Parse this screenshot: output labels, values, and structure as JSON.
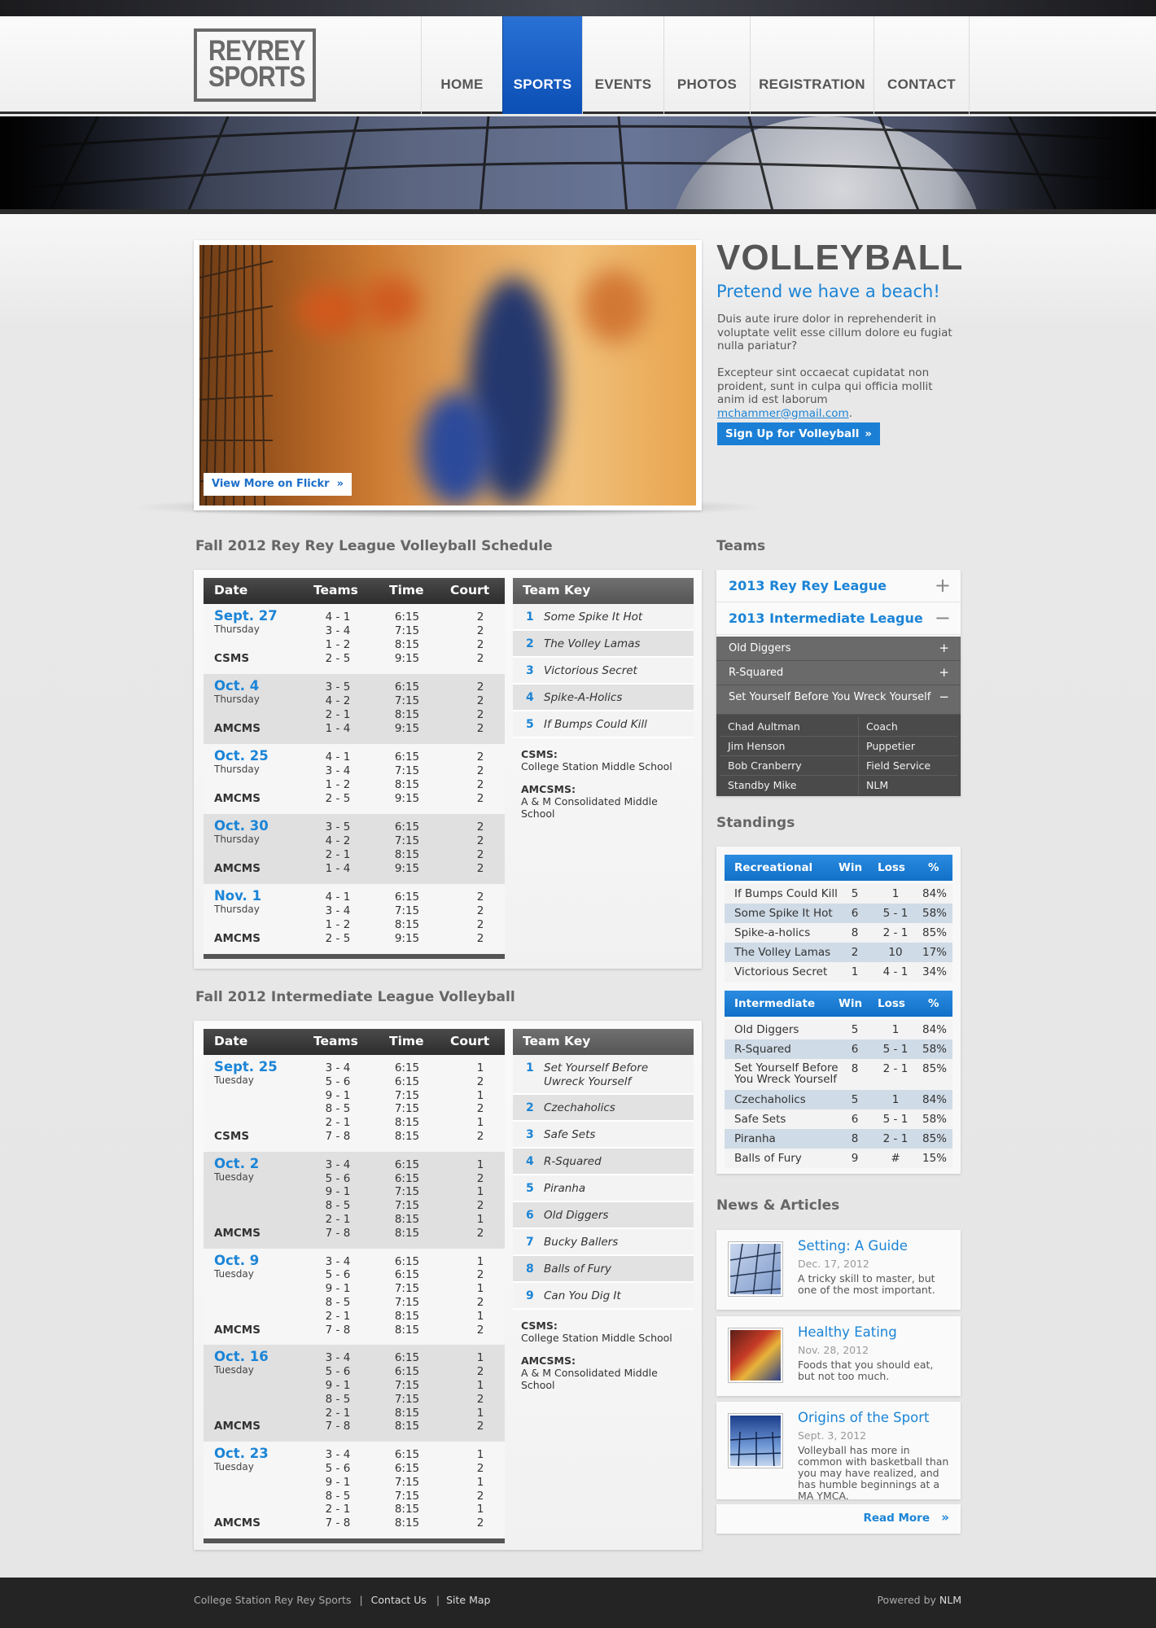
{
  "brand": {
    "logo_line1": "REYREY",
    "logo_line2": "SPORTS"
  },
  "nav": [
    "HOME",
    "SPORTS",
    "EVENTS",
    "PHOTOS",
    "REGISTRATION",
    "CONTACT"
  ],
  "nav_active": "SPORTS",
  "colors": {
    "accent": "#1b84d6",
    "nav_active": "#0b4fb5",
    "header_dark": "#2d2d2d",
    "footer": "#242424"
  },
  "feature": {
    "flickr_label": "View More on Flickr",
    "title": "VOLLEYBALL",
    "subtitle": "Pretend we have a beach!",
    "para1": "Duis aute irure dolor in reprehenderit in voluptate velit esse cillum dolore eu fugiat nulla pariatur?",
    "para2_text": "Excepteur sint occaecat cupidatat non proident, sunt in culpa qui officia mollit anim id est laborum ",
    "para2_email": "mchammer@gmail.com",
    "para2_end": ".",
    "signup_label": "Sign Up for Volleyball"
  },
  "schedule1": {
    "heading": "Fall 2012 Rey Rey League Volleyball Schedule",
    "headers": [
      "Date",
      "Teams",
      "Time",
      "Court"
    ],
    "groups": [
      {
        "date": "Sept. 27",
        "day": "Thursday",
        "location": "CSMS",
        "rows": [
          [
            "4 - 1",
            "6:15",
            "2"
          ],
          [
            "3 - 4",
            "7:15",
            "2"
          ],
          [
            "1 - 2",
            "8:15",
            "2"
          ],
          [
            "2 - 5",
            "9:15",
            "2"
          ]
        ]
      },
      {
        "date": "Oct. 4",
        "day": "Thursday",
        "location": "AMCMS",
        "rows": [
          [
            "3 - 5",
            "6:15",
            "2"
          ],
          [
            "4 - 2",
            "7:15",
            "2"
          ],
          [
            "2 - 1",
            "8:15",
            "2"
          ],
          [
            "1 - 4",
            "9:15",
            "2"
          ]
        ]
      },
      {
        "date": "Oct. 25",
        "day": "Thursday",
        "location": "AMCMS",
        "rows": [
          [
            "4 - 1",
            "6:15",
            "2"
          ],
          [
            "3 - 4",
            "7:15",
            "2"
          ],
          [
            "1 - 2",
            "8:15",
            "2"
          ],
          [
            "2 - 5",
            "9:15",
            "2"
          ]
        ]
      },
      {
        "date": "Oct. 30",
        "day": "Thursday",
        "location": "AMCMS",
        "rows": [
          [
            "3 - 5",
            "6:15",
            "2"
          ],
          [
            "4 - 2",
            "7:15",
            "2"
          ],
          [
            "2 - 1",
            "8:15",
            "2"
          ],
          [
            "1 - 4",
            "9:15",
            "2"
          ]
        ]
      },
      {
        "date": "Nov. 1",
        "day": "Thursday",
        "location": "AMCMS",
        "rows": [
          [
            "4 - 1",
            "6:15",
            "2"
          ],
          [
            "3 - 4",
            "7:15",
            "2"
          ],
          [
            "1 - 2",
            "8:15",
            "2"
          ],
          [
            "2 - 5",
            "9:15",
            "2"
          ]
        ]
      }
    ],
    "key_heading": "Team Key",
    "key": [
      "Some Spike It Hot",
      "The Volley Lamas",
      "Victorious Secret",
      "Spike-A-Holics",
      "If Bumps Could Kill"
    ],
    "notes": [
      {
        "abbr": "CSMS:",
        "full": "College Station Middle School"
      },
      {
        "abbr": "AMCSMS:",
        "full": "A & M Consolidated Middle School"
      }
    ]
  },
  "schedule2": {
    "heading": "Fall 2012 Intermediate League Volleyball",
    "headers": [
      "Date",
      "Teams",
      "Time",
      "Court"
    ],
    "groups": [
      {
        "date": "Sept. 25",
        "day": "Tuesday",
        "location": "CSMS",
        "rows": [
          [
            "3 - 4",
            "6:15",
            "1"
          ],
          [
            "5 - 6",
            "6:15",
            "2"
          ],
          [
            "9 - 1",
            "7:15",
            "1"
          ],
          [
            "8 - 5",
            "7:15",
            "2"
          ],
          [
            "2 - 1",
            "8:15",
            "1"
          ],
          [
            "7 - 8",
            "8:15",
            "2"
          ]
        ]
      },
      {
        "date": "Oct. 2",
        "day": "Tuesday",
        "location": "AMCMS",
        "rows": [
          [
            "3 - 4",
            "6:15",
            "1"
          ],
          [
            "5 - 6",
            "6:15",
            "2"
          ],
          [
            "9 - 1",
            "7:15",
            "1"
          ],
          [
            "8 - 5",
            "7:15",
            "2"
          ],
          [
            "2 - 1",
            "8:15",
            "1"
          ],
          [
            "7 - 8",
            "8:15",
            "2"
          ]
        ]
      },
      {
        "date": "Oct. 9",
        "day": "Tuesday",
        "location": "AMCMS",
        "rows": [
          [
            "3 - 4",
            "6:15",
            "1"
          ],
          [
            "5 - 6",
            "6:15",
            "2"
          ],
          [
            "9 - 1",
            "7:15",
            "1"
          ],
          [
            "8 - 5",
            "7:15",
            "2"
          ],
          [
            "2 - 1",
            "8:15",
            "1"
          ],
          [
            "7 - 8",
            "8:15",
            "2"
          ]
        ]
      },
      {
        "date": "Oct. 16",
        "day": "Tuesday",
        "location": "AMCMS",
        "rows": [
          [
            "3 - 4",
            "6:15",
            "1"
          ],
          [
            "5 - 6",
            "6:15",
            "2"
          ],
          [
            "9 - 1",
            "7:15",
            "1"
          ],
          [
            "8 - 5",
            "7:15",
            "2"
          ],
          [
            "2 - 1",
            "8:15",
            "1"
          ],
          [
            "7 - 8",
            "8:15",
            "2"
          ]
        ]
      },
      {
        "date": "Oct. 23",
        "day": "Tuesday",
        "location": "AMCMS",
        "rows": [
          [
            "3 - 4",
            "6:15",
            "1"
          ],
          [
            "5 - 6",
            "6:15",
            "2"
          ],
          [
            "9 - 1",
            "7:15",
            "1"
          ],
          [
            "8 - 5",
            "7:15",
            "2"
          ],
          [
            "2 - 1",
            "8:15",
            "1"
          ],
          [
            "7 - 8",
            "8:15",
            "2"
          ]
        ]
      }
    ],
    "key_heading": "Team Key",
    "key": [
      "Set Yourself Before Uwreck Yourself",
      "Czechaholics",
      "Safe Sets",
      "R-Squared",
      "Piranha",
      "Old Diggers",
      "Bucky Ballers",
      "Balls of Fury",
      "Can You Dig It"
    ],
    "notes": [
      {
        "abbr": "CSMS:",
        "full": "College Station Middle School"
      },
      {
        "abbr": "AMCSMS:",
        "full": "A & M Consolidated Middle School"
      }
    ]
  },
  "teams": {
    "heading": "Teams",
    "leagues": [
      {
        "label": "2013 Rey Rey League",
        "toggle": "+"
      },
      {
        "label": "2013 Intermediate League",
        "toggle": "−"
      }
    ],
    "team_list": [
      {
        "label": "Old Diggers",
        "toggle": "+"
      },
      {
        "label": "R-Squared",
        "toggle": "+"
      },
      {
        "label": "Set Yourself Before You Wreck Yourself",
        "toggle": "−"
      }
    ],
    "roster": [
      [
        "Chad Aultman",
        "Coach"
      ],
      [
        "Jim Henson",
        "Puppetier"
      ],
      [
        "Bob Cranberry",
        "Field Service"
      ],
      [
        "Standby Mike",
        "NLM"
      ]
    ]
  },
  "standings": {
    "heading": "Standings",
    "tables": [
      {
        "headers": [
          "Recreational",
          "Win",
          "Loss",
          "%"
        ],
        "rows": [
          [
            "If Bumps Could Kill",
            "5",
            "1",
            "84%"
          ],
          [
            "Some Spike It Hot",
            "6",
            "5 - 1",
            "58%"
          ],
          [
            "Spike-a-holics",
            "8",
            "2 - 1",
            "85%"
          ],
          [
            "The Volley Lamas",
            "2",
            "10",
            "17%"
          ],
          [
            "Victorious Secret",
            "1",
            "4 - 1",
            "34%"
          ]
        ]
      },
      {
        "headers": [
          "Intermediate",
          "Win",
          "Loss",
          "%"
        ],
        "rows": [
          [
            "Old Diggers",
            "5",
            "1",
            "84%"
          ],
          [
            "R-Squared",
            "6",
            "5 - 1",
            "58%"
          ],
          [
            "Set Yourself Before You Wreck Yourself",
            "8",
            "2 - 1",
            "85%"
          ],
          [
            "Czechaholics",
            "5",
            "1",
            "84%"
          ],
          [
            "Safe Sets",
            "6",
            "5 - 1",
            "58%"
          ],
          [
            "Piranha",
            "8",
            "2 - 1",
            "85%"
          ],
          [
            "Balls of Fury",
            "9",
            "#",
            "15%"
          ]
        ]
      }
    ]
  },
  "news": {
    "heading": "News & Articles",
    "articles": [
      {
        "title": "Setting: A Guide",
        "date": "Dec. 17, 2012",
        "text": "A tricky skill to master, but one of the most important."
      },
      {
        "title": "Healthy Eating",
        "date": "Nov. 28, 2012",
        "text": "Foods that you should eat, but not too much."
      },
      {
        "title": "Origins of the Sport",
        "date": "Sept. 3, 2012",
        "text": "Volleyball has more in common with basketball than you may have realized, and has humble beginnings at a MA YMCA."
      }
    ],
    "read_more": "Read More"
  },
  "footer": {
    "site": "College Station Rey Rey Sports",
    "sep": "|",
    "contact": "Contact Us",
    "sitemap": "Site Map",
    "powered": "Powered by ",
    "powered_by": "NLM"
  }
}
